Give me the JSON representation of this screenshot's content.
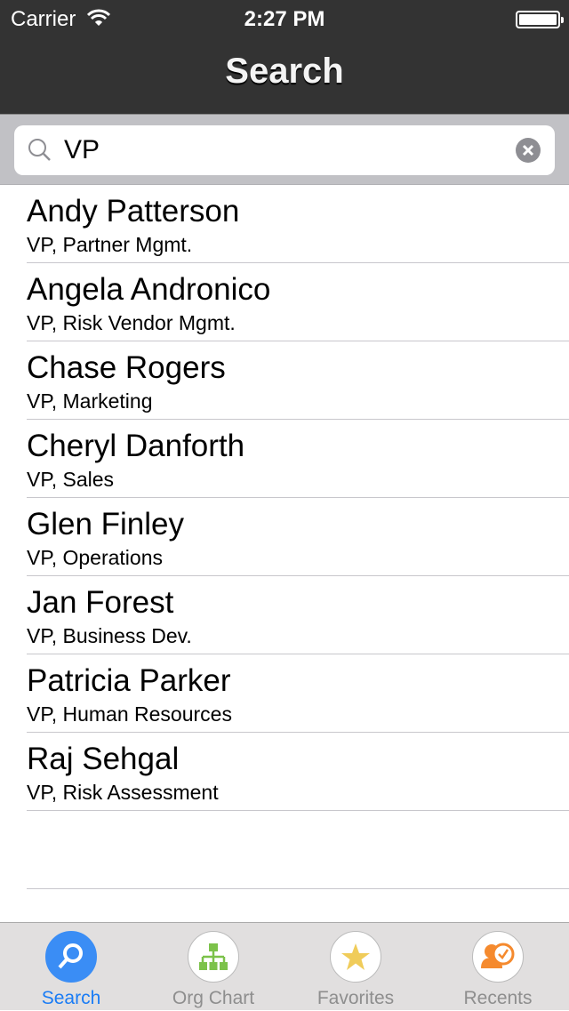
{
  "status": {
    "carrier": "Carrier",
    "time": "2:27 PM",
    "battery_level": 1.0
  },
  "header": {
    "title": "Search"
  },
  "search": {
    "value": "VP",
    "placeholder": "Search"
  },
  "results": [
    {
      "name": "Andy Patterson",
      "role": "VP, Partner Mgmt."
    },
    {
      "name": "Angela Andronico",
      "role": "VP, Risk Vendor Mgmt."
    },
    {
      "name": "Chase Rogers",
      "role": "VP, Marketing"
    },
    {
      "name": "Cheryl Danforth",
      "role": "VP, Sales"
    },
    {
      "name": "Glen Finley",
      "role": "VP, Operations"
    },
    {
      "name": "Jan Forest",
      "role": "VP, Business Dev."
    },
    {
      "name": "Patricia Parker",
      "role": "VP, Human Resources"
    },
    {
      "name": "Raj Sehgal",
      "role": "VP, Risk Assessment"
    }
  ],
  "tabs": [
    {
      "label": "Search",
      "icon": "search-icon",
      "active": true
    },
    {
      "label": "Org Chart",
      "icon": "org-chart-icon"
    },
    {
      "label": "Favorites",
      "icon": "star-icon"
    },
    {
      "label": "Recents",
      "icon": "recents-icon"
    }
  ],
  "colors": {
    "accent": "#1a7cf5",
    "header": "#333333",
    "orgchart": "#7cc24a",
    "star": "#f0cc5a",
    "recents": "#f58a2e"
  }
}
